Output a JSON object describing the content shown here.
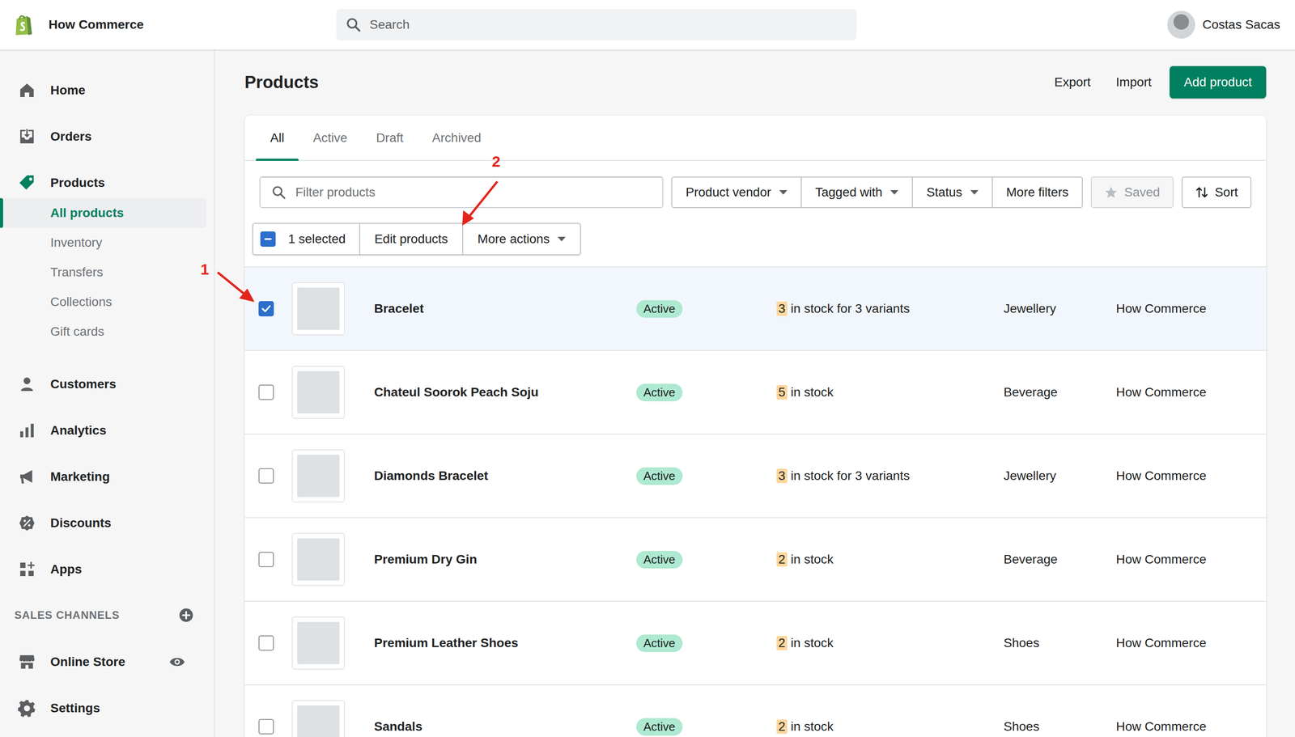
{
  "store": {
    "name": "How Commerce"
  },
  "search": {
    "placeholder": "Search"
  },
  "user": {
    "name": "Costas Sacas"
  },
  "sidebar": {
    "items": [
      {
        "label": "Home",
        "kind": "main",
        "selected": false
      },
      {
        "label": "Orders",
        "kind": "main",
        "selected": false
      },
      {
        "label": "Products",
        "kind": "main",
        "selected": true
      },
      {
        "label": "All products",
        "kind": "sub",
        "selected": true
      },
      {
        "label": "Inventory",
        "kind": "sub",
        "selected": false
      },
      {
        "label": "Transfers",
        "kind": "sub",
        "selected": false
      },
      {
        "label": "Collections",
        "kind": "sub",
        "selected": false
      },
      {
        "label": "Gift cards",
        "kind": "sub",
        "selected": false
      },
      {
        "label": "Customers",
        "kind": "main",
        "selected": false
      },
      {
        "label": "Analytics",
        "kind": "main",
        "selected": false
      },
      {
        "label": "Marketing",
        "kind": "main",
        "selected": false
      },
      {
        "label": "Discounts",
        "kind": "main",
        "selected": false
      },
      {
        "label": "Apps",
        "kind": "main",
        "selected": false
      }
    ]
  },
  "sales_channels": {
    "title": "SALES CHANNELS",
    "items": [
      {
        "label": "Online Store"
      }
    ]
  },
  "settings": {
    "label": "Settings"
  },
  "page": {
    "title": "Products",
    "actions": [
      "Export",
      "Import"
    ],
    "primary": "Add product"
  },
  "tabs": [
    {
      "label": "All",
      "selected": true
    },
    {
      "label": "Active",
      "selected": false
    },
    {
      "label": "Draft",
      "selected": false
    },
    {
      "label": "Archived",
      "selected": false
    }
  ],
  "filters": {
    "placeholder": "Filter products",
    "dropdowns": [
      {
        "label": "Product vendor",
        "dropdown": true
      },
      {
        "label": "Tagged with",
        "dropdown": true
      },
      {
        "label": "Status",
        "dropdown": true
      },
      {
        "label": "More filters",
        "dropdown": false
      }
    ],
    "saved": {
      "label": "Saved",
      "disabled": true
    },
    "sort": {
      "label": "Sort"
    }
  },
  "bulk": {
    "label": "1 selected",
    "indeterminate": true,
    "actions": [
      "Edit products"
    ],
    "more": "More actions"
  },
  "rows": [
    {
      "name": "Bracelet",
      "status": "Active",
      "count": "3",
      "stock": "in stock for 3 variants",
      "type": "Jewellery",
      "vendor": "How Commerce",
      "selected": true
    },
    {
      "name": "Chateul Soorok Peach Soju",
      "status": "Active",
      "count": "5",
      "stock": "in stock",
      "type": "Beverage",
      "vendor": "How Commerce",
      "selected": false
    },
    {
      "name": "Diamonds Bracelet",
      "status": "Active",
      "count": "3",
      "stock": "in stock for 3 variants",
      "type": "Jewellery",
      "vendor": "How Commerce",
      "selected": false
    },
    {
      "name": "Premium Dry Gin",
      "status": "Active",
      "count": "2",
      "stock": "in stock",
      "type": "Beverage",
      "vendor": "How Commerce",
      "selected": false
    },
    {
      "name": "Premium Leather Shoes",
      "status": "Active",
      "count": "2",
      "stock": "in stock",
      "type": "Shoes",
      "vendor": "How Commerce",
      "selected": false
    },
    {
      "name": "Sandals",
      "status": "Active",
      "count": "2",
      "stock": "in stock",
      "type": "Shoes",
      "vendor": "How Commerce",
      "selected": false
    }
  ],
  "annotations": [
    {
      "label": "1"
    },
    {
      "label": "2"
    }
  ]
}
